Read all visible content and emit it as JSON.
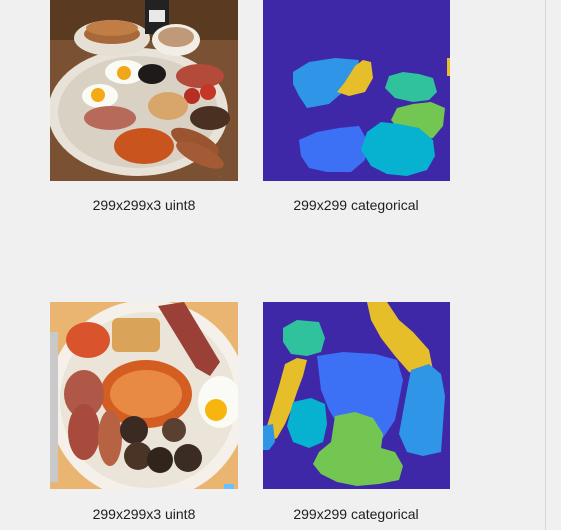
{
  "rows": [
    {
      "image_caption": "299x299x3 uint8",
      "label_caption": "299x299 categorical"
    },
    {
      "image_caption": "299x299x3 uint8",
      "label_caption": "299x299 categorical"
    }
  ],
  "colors": {
    "background": "#f0f0f0",
    "label_background": "#3e28a8",
    "class_light_blue": "#2f95e6",
    "class_yellow": "#e5be2a",
    "class_teal": "#30c29c",
    "class_green": "#74c653",
    "class_cyan": "#06b2cf",
    "class_blue": "#3d71f5"
  }
}
